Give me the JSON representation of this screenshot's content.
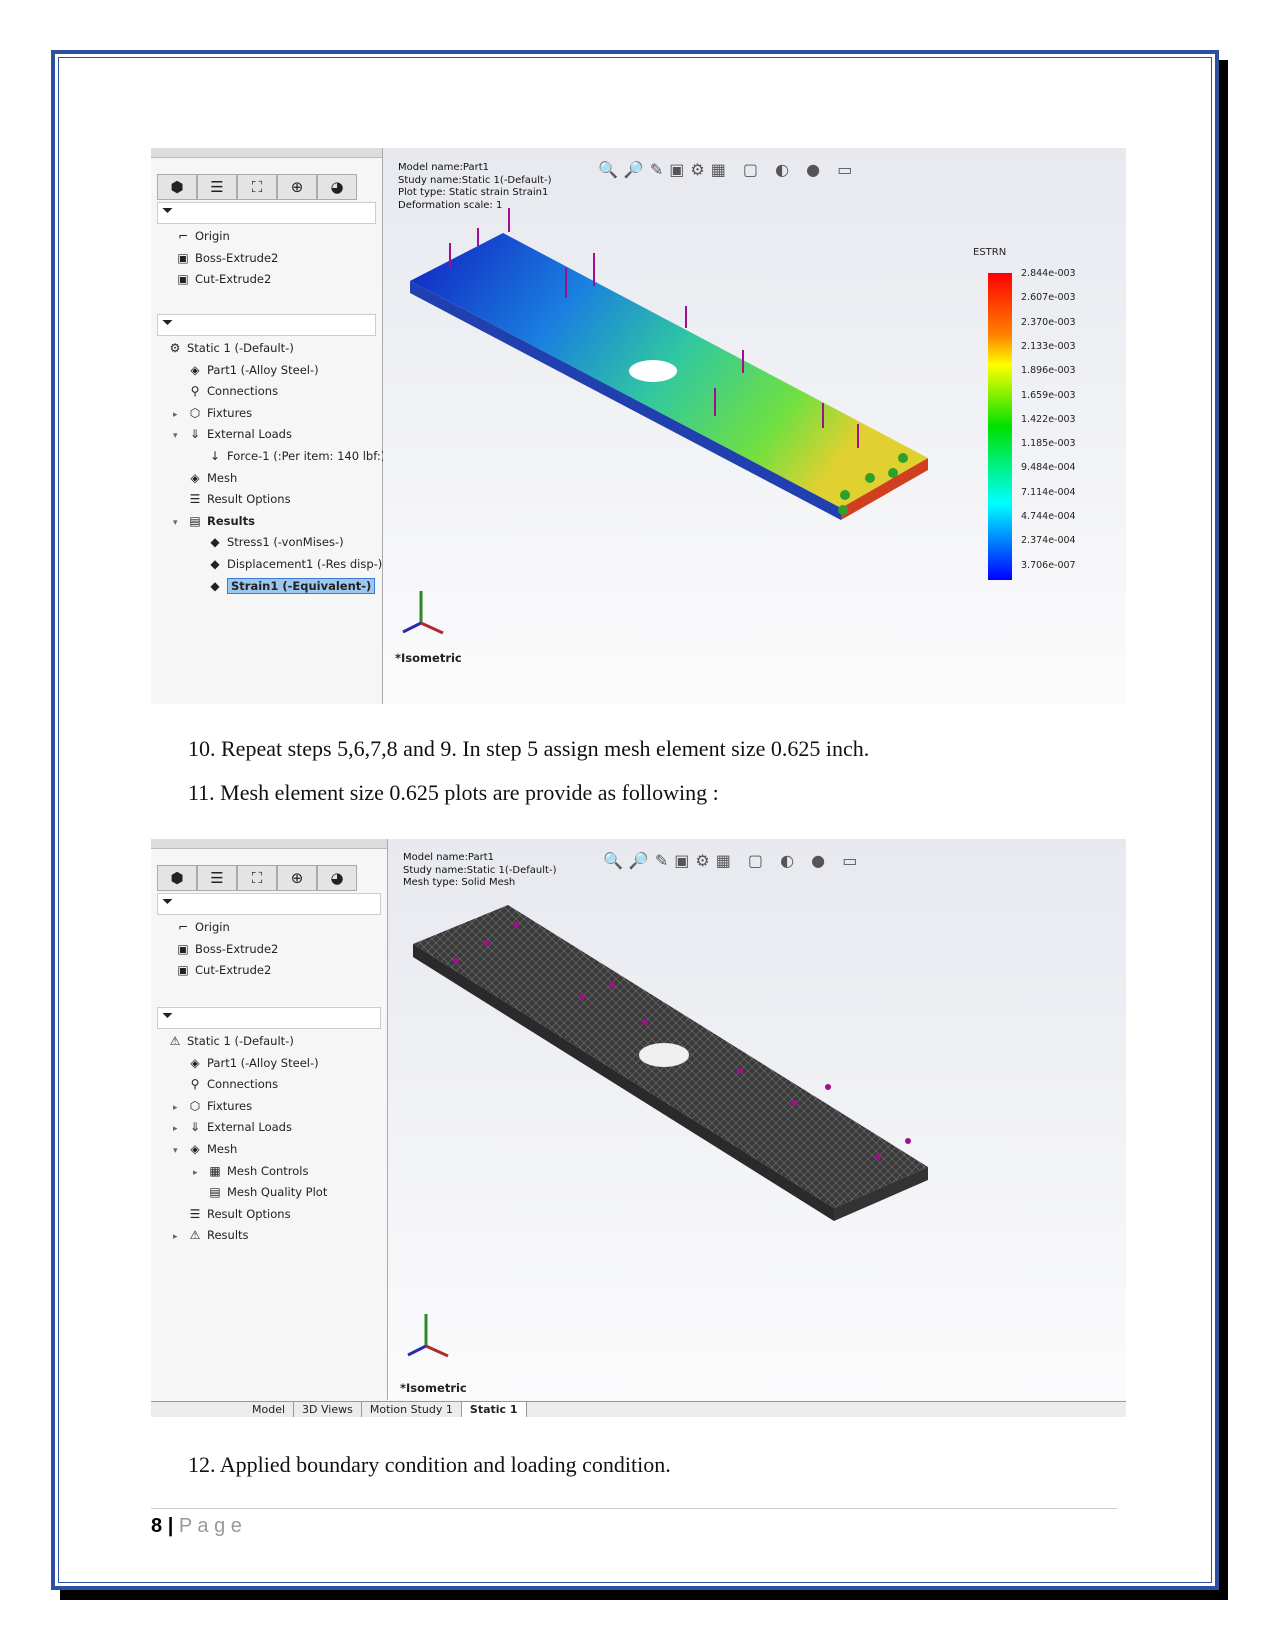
{
  "screenshot1": {
    "icons": [
      "part-icon",
      "feature-tree-icon",
      "config-icon",
      "target-icon",
      "appearance-icon"
    ],
    "tree_top": [
      {
        "label": "Origin",
        "icon": "⌐"
      },
      {
        "label": "Boss-Extrude2",
        "icon": "▣"
      },
      {
        "label": "Cut-Extrude2",
        "icon": "▣"
      }
    ],
    "tree": [
      {
        "label": "Static 1 (-Default-)",
        "icon": "⚙",
        "indent": 0
      },
      {
        "label": "Part1 (-Alloy Steel-)",
        "icon": "◈",
        "indent": 1
      },
      {
        "label": "Connections",
        "icon": "⚲",
        "indent": 1
      },
      {
        "label": "Fixtures",
        "icon": "⬡",
        "indent": 1,
        "arrow": "▸"
      },
      {
        "label": "External Loads",
        "icon": "⇓",
        "indent": 1,
        "arrow": "▾"
      },
      {
        "label": "Force-1 (:Per item: 140 lbf:)",
        "icon": "↓",
        "indent": 2
      },
      {
        "label": "Mesh",
        "icon": "◈",
        "indent": 1
      },
      {
        "label": "Result Options",
        "icon": "☰",
        "indent": 1
      },
      {
        "label": "Results",
        "icon": "▤",
        "indent": 1,
        "arrow": "▾",
        "bold": true
      },
      {
        "label": "Stress1 (-vonMises-)",
        "icon": "◆",
        "indent": 2
      },
      {
        "label": "Displacement1 (-Res disp-)",
        "icon": "◆",
        "indent": 2
      },
      {
        "label": "Strain1 (-Equivalent-)",
        "icon": "◆",
        "indent": 2,
        "selected": true
      }
    ],
    "info": [
      "Model name:Part1",
      "Study name:Static 1(-Default-)",
      "Plot type: Static strain Strain1",
      "Deformation scale: 1"
    ],
    "view_label": "*Isometric",
    "legend": {
      "title": "ESTRN",
      "labels": [
        "2.844e-003",
        "2.607e-003",
        "2.370e-003",
        "2.133e-003",
        "1.896e-003",
        "1.659e-003",
        "1.422e-003",
        "1.185e-003",
        "9.484e-004",
        "7.114e-004",
        "4.744e-004",
        "2.374e-004",
        "3.706e-007"
      ],
      "colors": [
        "#ff0000",
        "#ff8000",
        "#ffff00",
        "#00ff00",
        "#00ffff",
        "#0000ff"
      ]
    }
  },
  "step10": "10. Repeat steps 5,6,7,8 and 9. In step 5 assign mesh element size 0.625 inch.",
  "step11": "11. Mesh element size 0.625  plots are  provide as following :",
  "screenshot2": {
    "icons": [
      "part-icon",
      "feature-tree-icon",
      "config-icon",
      "target-icon",
      "appearance-icon"
    ],
    "tree_top": [
      {
        "label": "Origin",
        "icon": "⌐"
      },
      {
        "label": "Boss-Extrude2",
        "icon": "▣",
        "arrow": "▸"
      },
      {
        "label": "Cut-Extrude2",
        "icon": "▣",
        "arrow": "▸"
      }
    ],
    "tree": [
      {
        "label": "Static 1 (-Default-)",
        "icon": "⚠",
        "indent": 0
      },
      {
        "label": "Part1 (-Alloy Steel-)",
        "icon": "◈",
        "indent": 1
      },
      {
        "label": "Connections",
        "icon": "⚲",
        "indent": 1
      },
      {
        "label": "Fixtures",
        "icon": "⬡",
        "indent": 1,
        "arrow": "▸"
      },
      {
        "label": "External Loads",
        "icon": "⇓",
        "indent": 1,
        "arrow": "▸"
      },
      {
        "label": "Mesh",
        "icon": "◈",
        "indent": 1,
        "arrow": "▾"
      },
      {
        "label": "Mesh Controls",
        "icon": "▦",
        "indent": 2,
        "arrow": "▸"
      },
      {
        "label": "Mesh Quality Plot",
        "icon": "▤",
        "indent": 2
      },
      {
        "label": "Result Options",
        "icon": "☰",
        "indent": 1
      },
      {
        "label": "Results",
        "icon": "⚠",
        "indent": 1,
        "arrow": "▸"
      }
    ],
    "info": [
      "Model name:Part1",
      "Study name:Static 1(-Default-)",
      "Mesh type: Solid Mesh"
    ],
    "view_label": "*Isometric",
    "bottom_tabs": [
      "Model",
      "3D Views",
      "Motion Study 1",
      "Static 1"
    ]
  },
  "step12": "12. Applied boundary condition and loading condition.",
  "footer": {
    "page": "8",
    "sep": "|",
    "label": "P a g e"
  }
}
